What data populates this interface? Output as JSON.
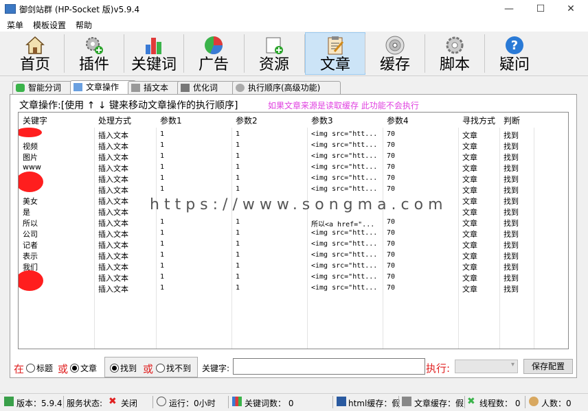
{
  "window": {
    "title": "御剑站群 (HP-Socket 版)v5.9.4",
    "min": "—",
    "max": "☐",
    "close": "✕"
  },
  "menu": [
    "菜单",
    "模板设置",
    "帮助"
  ],
  "toolbar": [
    {
      "label": "首页",
      "icon": "home-icon"
    },
    {
      "label": "插件",
      "icon": "gear-plus-icon"
    },
    {
      "label": "关键词",
      "icon": "bar-chart-icon"
    },
    {
      "label": "广告",
      "icon": "pie-chart-icon"
    },
    {
      "label": "资源",
      "icon": "add-file-icon"
    },
    {
      "label": "文章",
      "icon": "clipboard-icon",
      "active": true
    },
    {
      "label": "缓存",
      "icon": "disc-icon"
    },
    {
      "label": "脚本",
      "icon": "settings-icon"
    },
    {
      "label": "疑问",
      "icon": "help-icon"
    }
  ],
  "tabs": [
    {
      "label": "智能分词",
      "icon": "heart-icon"
    },
    {
      "label": "文章操作",
      "icon": "edit-icon",
      "active": true
    },
    {
      "label": "插文本",
      "icon": "link-icon"
    },
    {
      "label": "优化词",
      "icon": "printer-icon"
    },
    {
      "label": "执行顺序(高级功能)",
      "icon": "gear-icon"
    }
  ],
  "group": {
    "label": "文章操作:[使用 ↑ ↓ 键来移动文章操作的执行顺序]",
    "note": "如果文章来源是读取缓存 此功能不会执行"
  },
  "columns": [
    "关键字",
    "处理方式",
    "参数1",
    "参数2",
    "参数3",
    "参数4",
    "寻找方式",
    "判断"
  ],
  "rows": [
    [
      "",
      "插入文本",
      "1",
      "1",
      "<img src=\"htt...",
      "70",
      "文章",
      "找到"
    ],
    [
      "视频",
      "插入文本",
      "1",
      "1",
      "<img src=\"htt...",
      "70",
      "文章",
      "找到"
    ],
    [
      "图片",
      "插入文本",
      "1",
      "1",
      "<img src=\"htt...",
      "70",
      "文章",
      "找到"
    ],
    [
      "www",
      "插入文本",
      "1",
      "1",
      "<img src=\"htt...",
      "70",
      "文章",
      "找到"
    ],
    [
      "",
      "插入文本",
      "1",
      "1",
      "<img src=\"htt...",
      "70",
      "文章",
      "找到"
    ],
    [
      "",
      "插入文本",
      "1",
      "1",
      "<img src=\"htt...",
      "70",
      "文章",
      "找到"
    ],
    [
      "美女",
      "插入文本",
      "",
      "",
      "",
      "",
      "文章",
      "找到"
    ],
    [
      "是",
      "插入文本",
      "",
      "",
      "",
      "",
      "文章",
      "找到"
    ],
    [
      "所以",
      "插入文本",
      "1",
      "1",
      "所以<a href=\"...",
      "70",
      "文章",
      "找到"
    ],
    [
      "公司",
      "插入文本",
      "1",
      "1",
      "<img src=\"htt...",
      "70",
      "文章",
      "找到"
    ],
    [
      "记者",
      "插入文本",
      "1",
      "1",
      "<img src=\"htt...",
      "70",
      "文章",
      "找到"
    ],
    [
      "表示",
      "插入文本",
      "1",
      "1",
      "<img src=\"htt...",
      "70",
      "文章",
      "找到"
    ],
    [
      "我们",
      "插入文本",
      "1",
      "1",
      "<img src=\"htt...",
      "70",
      "文章",
      "找到"
    ],
    [
      "",
      "插入文本",
      "1",
      "1",
      "<img src=\"htt...",
      "70",
      "文章",
      "找到"
    ],
    [
      "",
      "插入文本",
      "1",
      "1",
      "<img src=\"htt...",
      "70",
      "文章",
      "找到"
    ]
  ],
  "watermark": "https://www.songma.com",
  "bottom": {
    "in": "在",
    "title": "标题",
    "or1": "或",
    "article": "文章",
    "found": "找到",
    "or2": "或",
    "notfound": "找不到",
    "keyword_label": "关键字:",
    "keyword_value": "",
    "exec_label": "执行:",
    "exec_value": "",
    "save": "保存配置"
  },
  "status": [
    {
      "text": "版本：5.9.4",
      "icon": "version-icon"
    },
    {
      "text": "服务状态:",
      "icon": ""
    },
    {
      "text": "关闭",
      "icon": "close-x-icon"
    },
    {
      "text": "运行：0小时",
      "icon": "clock-icon"
    },
    {
      "text": "关键词数： 0",
      "icon": "chart-icon"
    },
    {
      "text": "html缓存：假",
      "icon": "html-icon"
    },
    {
      "text": "文章缓存：假",
      "icon": "doc-icon"
    },
    {
      "text": "线程数： 0",
      "icon": "threads-icon"
    },
    {
      "text": "人数：0",
      "icon": "users-icon"
    }
  ]
}
